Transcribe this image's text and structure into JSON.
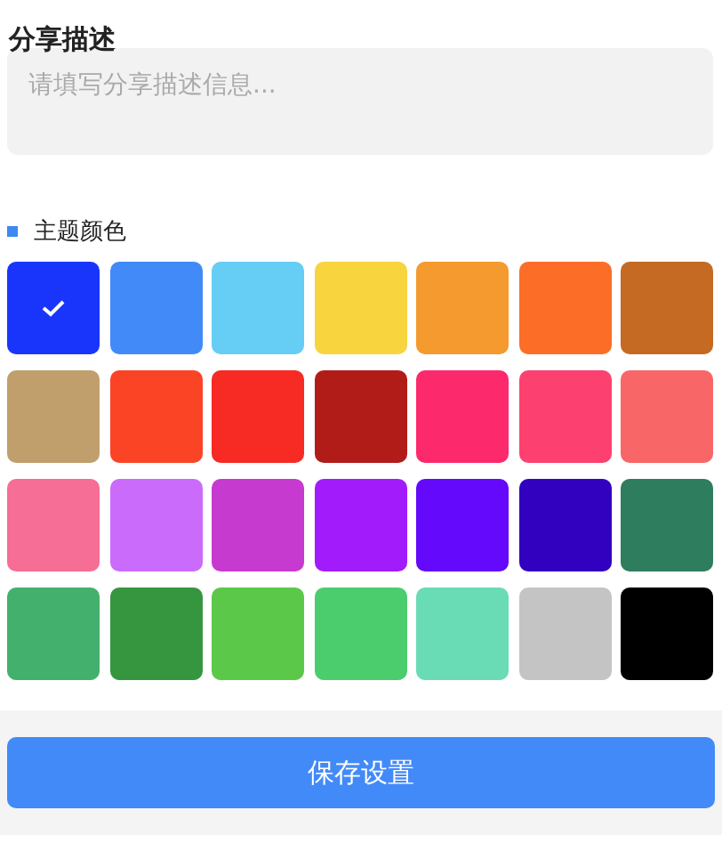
{
  "description": {
    "title": "分享描述",
    "placeholder": "请填写分享描述信息..."
  },
  "theme": {
    "title": "主题颜色",
    "swatches": [
      {
        "color": "#1a35fb",
        "selected": true
      },
      {
        "color": "#428af8",
        "selected": false
      },
      {
        "color": "#66cdf4",
        "selected": false
      },
      {
        "color": "#f8d43f",
        "selected": false
      },
      {
        "color": "#f49a2f",
        "selected": false
      },
      {
        "color": "#fc6e27",
        "selected": false
      },
      {
        "color": "#c56a22",
        "selected": false
      },
      {
        "color": "#c19f6c",
        "selected": false
      },
      {
        "color": "#fb4426",
        "selected": false
      },
      {
        "color": "#f72a24",
        "selected": false
      },
      {
        "color": "#b21c18",
        "selected": false
      },
      {
        "color": "#fc2a6d",
        "selected": false
      },
      {
        "color": "#fc4170",
        "selected": false
      },
      {
        "color": "#f96667",
        "selected": false
      },
      {
        "color": "#f66d95",
        "selected": false
      },
      {
        "color": "#cb6bfc",
        "selected": false
      },
      {
        "color": "#c73ad0",
        "selected": false
      },
      {
        "color": "#a21cfb",
        "selected": false
      },
      {
        "color": "#6409fb",
        "selected": false
      },
      {
        "color": "#3201bf",
        "selected": false
      },
      {
        "color": "#2f7d5f",
        "selected": false
      },
      {
        "color": "#44b06d",
        "selected": false
      },
      {
        "color": "#35963f",
        "selected": false
      },
      {
        "color": "#5cc84a",
        "selected": false
      },
      {
        "color": "#4bcd6e",
        "selected": false
      },
      {
        "color": "#69dbb5",
        "selected": false
      },
      {
        "color": "#c4c4c4",
        "selected": false
      },
      {
        "color": "#000000",
        "selected": false
      }
    ]
  },
  "save_button": "保存设置"
}
